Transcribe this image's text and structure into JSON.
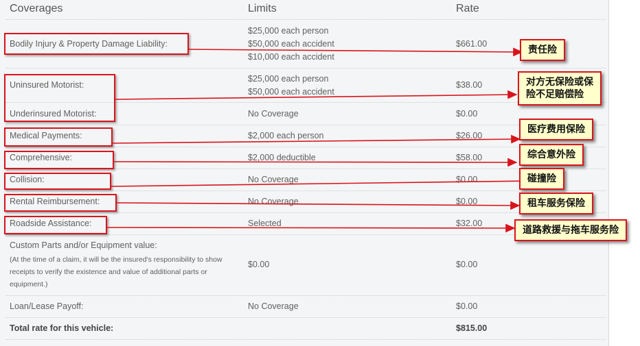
{
  "headers": {
    "coverages": "Coverages",
    "limits": "Limits",
    "rate": "Rate"
  },
  "rows": [
    {
      "coverage": "Bodily Injury & Property Damage Liability:",
      "limits": [
        "$25,000 each person",
        "$50,000 each accident",
        "$10,000 each accident"
      ],
      "rate": "$661.00"
    },
    {
      "coverage": "Uninsured Motorist:",
      "limits": [
        "$25,000 each person",
        "$50,000 each accident"
      ],
      "rate": "$38.00"
    },
    {
      "coverage": "Underinsured Motorist:",
      "limits": [
        "No Coverage"
      ],
      "rate": "$0.00"
    },
    {
      "coverage": "Medical Payments:",
      "limits": [
        "$2,000 each person"
      ],
      "rate": "$26.00"
    },
    {
      "coverage": "Comprehensive:",
      "limits": [
        "$2,000 deductible"
      ],
      "rate": "$58.00"
    },
    {
      "coverage": "Collision:",
      "limits": [
        "No Coverage"
      ],
      "rate": "$0.00"
    },
    {
      "coverage": "Rental Reimbursement:",
      "limits": [
        "No Coverage"
      ],
      "rate": "$0.00"
    },
    {
      "coverage": "Roadside Assistance:",
      "limits": [
        "Selected"
      ],
      "rate": "$32.00"
    },
    {
      "coverage": "Custom Parts and/or Equipment value:",
      "note": [
        "(At the time of a claim, it will be the insured's responsibility to show",
        "receipts to verify the existence and value of additional parts or",
        "equipment.)"
      ],
      "limits": [
        "$0.00"
      ],
      "rate": "$0.00"
    },
    {
      "coverage": "Loan/Lease Payoff:",
      "limits": [
        "No Coverage"
      ],
      "rate": "$0.00"
    }
  ],
  "total": {
    "label": "Total rate for this vehicle:",
    "rate": "$815.00"
  },
  "annotations": [
    {
      "text": "责任险"
    },
    {
      "lines": [
        "对方无保险或保",
        "险不足赔偿险"
      ]
    },
    {
      "text": "医疗费用保险"
    },
    {
      "text": "综合意外险"
    },
    {
      "text": "碰撞险"
    },
    {
      "text": "租车服务保险"
    },
    {
      "text": "道路救援与拖车服务险"
    }
  ],
  "colors": {
    "annotation_border": "#d8141c",
    "annotation_fill": "#ffffcc",
    "panel_bg": "#f4f5f6"
  }
}
